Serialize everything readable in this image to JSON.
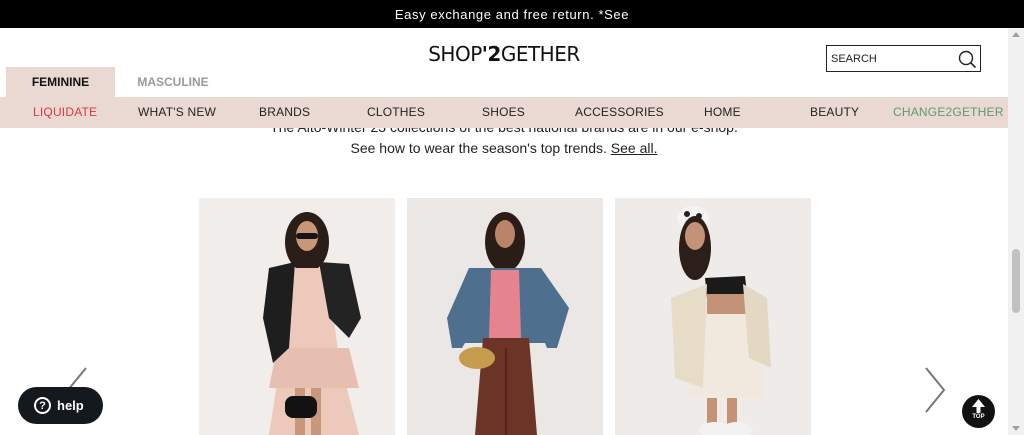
{
  "announcement": "Easy exchange and free return. *See",
  "logo": {
    "pre": "SHOP",
    "accent": "'2",
    "post": "GETHER"
  },
  "search": {
    "placeholder": "SEARCH"
  },
  "gender_tabs": {
    "feminine": "FEMININE",
    "masculine": "MASCULINE",
    "active": "feminine"
  },
  "nav": {
    "liquidate": "LIQUIDATE",
    "whats_new": "WHAT'S NEW",
    "brands": "BRANDS",
    "clothes": "CLOTHES",
    "shoes": "SHOES",
    "accessories": "ACCESSORIES",
    "home": "HOME",
    "beauty": "BEAUTY",
    "change2gether": "CHANGE2GETHER"
  },
  "intro": {
    "line1": "The Alto-Winter 23 collections of the best national brands are in our e-shop.",
    "line2": "See how to wear the season's top trends.",
    "link": "See all."
  },
  "carousel": {
    "items": [
      {
        "alt": "Model in black leather jacket and pink ruffled dress"
      },
      {
        "alt": "Model in denim shirt, pink top and brown trousers"
      },
      {
        "alt": "Model in black bralette, white skirt and cream cardigan"
      }
    ]
  },
  "help": {
    "label": "help"
  },
  "top_button": {
    "label": "TOP"
  },
  "colors": {
    "nav_bg": "#ead8d2",
    "liquidate": "#d9364a",
    "change2gether": "#5f9b6d",
    "topbar": "#000000"
  }
}
